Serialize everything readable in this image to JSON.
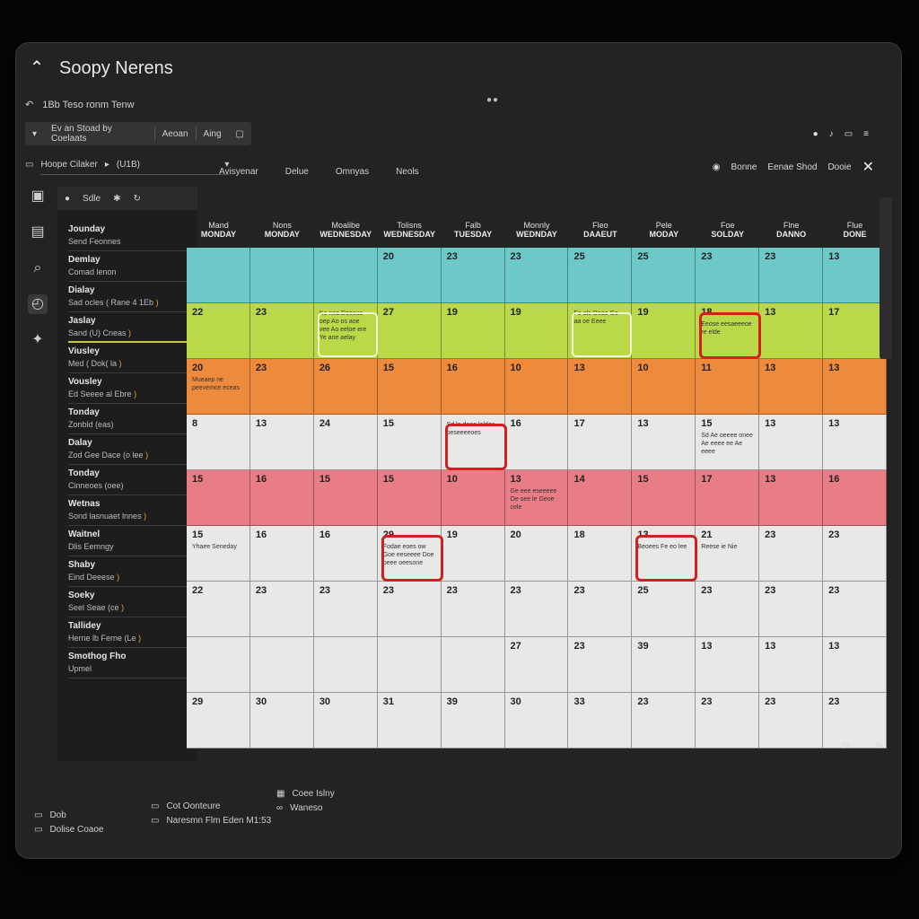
{
  "app": {
    "title": "Soopy Nerens",
    "subtitle": "1Bb Teso ronm Tenw"
  },
  "toolbar1": {
    "items": [
      "Ev an Stoad by Coelaats",
      "Aeoan",
      "Aing"
    ]
  },
  "toolbar2": {
    "dropdown": "Hoope Cilaker",
    "dropdown_value": "(U1B)",
    "tab0": "Avisyenar"
  },
  "tabs": [
    "Delue",
    "Omnyas",
    "Neols"
  ],
  "right_tools": [
    "Bonne",
    "Eenae Shod",
    "Dooie"
  ],
  "sidebar": {
    "header": "Sdle",
    "items": [
      {
        "title": "Jounday",
        "sub": "Send Feonnes",
        "tag": ""
      },
      {
        "title": "Demlay",
        "sub": "Comad lenon",
        "tag": ""
      },
      {
        "title": "Dialay",
        "sub": "Sad ocles ( Rane 4 1Eb",
        "tag": ")"
      },
      {
        "title": "Jaslay",
        "sub": "Sand (U) Cneas",
        "tag": ")"
      },
      {
        "title": "Viusley",
        "sub": "Med ( Dok( la",
        "tag": ")"
      },
      {
        "title": "Vousley",
        "sub": "Ed Seeee al Ebre",
        "tag": ")"
      },
      {
        "title": "Tonday",
        "sub": "Zonbld (eas)",
        "tag": ""
      },
      {
        "title": "Dalay",
        "sub": "Zod Gee Dace (o lee",
        "tag": ")"
      },
      {
        "title": "Tonday",
        "sub": "Cinneoes (oee)",
        "tag": ""
      },
      {
        "title": "Wetnas",
        "sub": "Sond lasnuaet lnnes",
        "tag": ")"
      },
      {
        "title": "Waitnel",
        "sub": "Dlis Eemngy",
        "tag": ""
      },
      {
        "title": "Shaby",
        "sub": "Eind Deeese",
        "tag": ")"
      },
      {
        "title": "Soeky",
        "sub": "Seel Seae (ce",
        "tag": ")"
      },
      {
        "title": "Tallidey",
        "sub": "Herne lb Ferne (Le",
        "tag": ")"
      },
      {
        "title": "Smothog Fho",
        "sub": "Upmel",
        "tag": ""
      }
    ]
  },
  "calendar": {
    "week_header": [
      "Mand",
      "Nons",
      "Moalibe",
      "Tolisns",
      "Falb",
      "Monnly",
      "Fleo",
      "Pele",
      "Foe",
      "Flne",
      "Flue"
    ],
    "days": [
      "MONDAY",
      "MONDAY",
      "WEDNESDAY",
      "WEDNESDAY",
      "TUESDAY",
      "WEDNDAY",
      "DAAEUT",
      "MODAY",
      "SOLDAY",
      "DANNO",
      "DONE"
    ],
    "rows": [
      {
        "color": "#6ec8c8",
        "cells": [
          "",
          "",
          "",
          "20",
          "23",
          "23",
          "25",
          "25",
          "23",
          "23",
          "13"
        ]
      },
      {
        "color": "#b9d948",
        "cells": [
          "22",
          "23",
          "",
          "27",
          "19",
          "19",
          "",
          "19",
          "18",
          "13",
          "17"
        ]
      },
      {
        "color": "#ee8a3c",
        "cells": [
          "20",
          "23",
          "26",
          "15",
          "16",
          "10",
          "13",
          "10",
          "11",
          "13",
          "13"
        ]
      },
      {
        "color": "#e8e8e6",
        "cells": [
          "8",
          "13",
          "24",
          "15",
          "",
          "16",
          "17",
          "13",
          "15",
          "13",
          "13"
        ]
      },
      {
        "color": "#e87d86",
        "cells": [
          "15",
          "16",
          "15",
          "15",
          "10",
          "13",
          "14",
          "15",
          "17",
          "13",
          "16"
        ]
      },
      {
        "color": "#e8e8e6",
        "cells": [
          "15",
          "16",
          "16",
          "29",
          "19",
          "20",
          "18",
          "13",
          "21",
          "23",
          "23"
        ]
      },
      {
        "color": "#e8e8e6",
        "cells": [
          "22",
          "23",
          "23",
          "23",
          "23",
          "23",
          "23",
          "25",
          "23",
          "23",
          "23"
        ]
      },
      {
        "color": "#e8e8e6",
        "cells": [
          "",
          "",
          "",
          "",
          "",
          "27",
          "23",
          "39",
          "13",
          "13",
          "13"
        ]
      },
      {
        "color": "#e8e8e6",
        "cells": [
          "29",
          "30",
          "30",
          "31",
          "39",
          "30",
          "33",
          "23",
          "23",
          "23",
          "23"
        ]
      }
    ],
    "notes": [
      {
        "row": 1,
        "col": 2,
        "text": "Ke nea Deeeus oep Ao os aoe vee Ao eeloe ere Ye ane aelay"
      },
      {
        "row": 1,
        "col": 6,
        "text": "Fo ale Deao Go aa oe Eeee"
      },
      {
        "row": 1,
        "col": 8,
        "text": "Eeose eesaeeeoe re elde"
      },
      {
        "row": 2,
        "col": 0,
        "text": "Mueaep ne peevemce eceas"
      },
      {
        "row": 3,
        "col": 4,
        "text": "Sd le deoe leldes oeseeeeoes"
      },
      {
        "row": 3,
        "col": 8,
        "text": "Sd Ae oeeee onee Ae eeee ee Ae eeee"
      },
      {
        "row": 4,
        "col": 5,
        "text": "Ge eee eseeeee Oe see le Geoe cele"
      },
      {
        "row": 5,
        "col": 0,
        "text": "Yhaee Seneday"
      },
      {
        "row": 5,
        "col": 3,
        "text": "Fodae eoes ow Goe eeseeee Doe oeee oeesone"
      },
      {
        "row": 5,
        "col": 7,
        "text": "Beoees Fe eo lee"
      },
      {
        "row": 5,
        "col": 8,
        "text": "Reese ie Nie"
      }
    ]
  },
  "footer": {
    "col1": [
      "Dob",
      "Dolise Coaoe"
    ],
    "col2": [
      "Cot Oonteure",
      "Naresmn Flm Eden M1:53"
    ],
    "col3": [
      "Coee Islny",
      "Waneso"
    ]
  }
}
